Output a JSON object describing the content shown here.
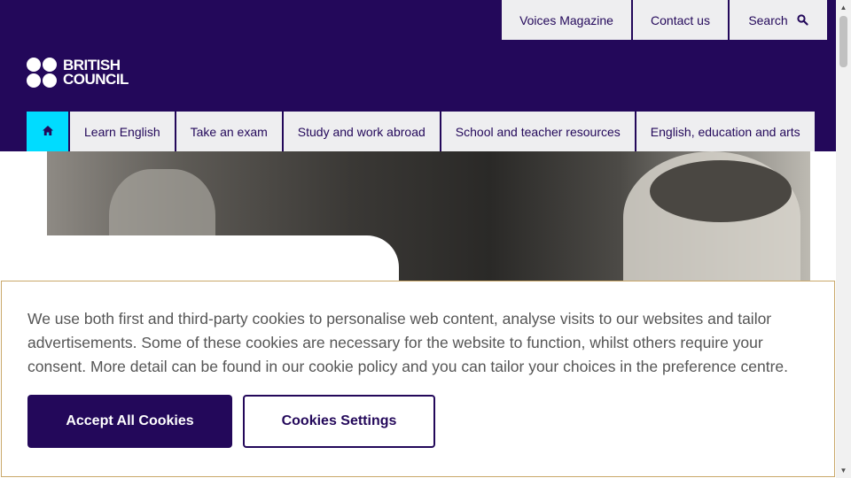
{
  "brand": {
    "line1": "BRITISH",
    "line2": "COUNCIL"
  },
  "util_nav": {
    "voices": "Voices Magazine",
    "contact": "Contact us",
    "search": "Search"
  },
  "main_nav": {
    "items": [
      "Learn English",
      "Take an exam",
      "Study and work abroad",
      "School and teacher resources",
      "English, education and arts"
    ]
  },
  "cookie_banner": {
    "text": "We use both first and third-party cookies to personalise web content, analyse visits to our websites and tailor advertisements. Some of these cookies are necessary for the website to function, whilst others require your consent. More detail can be found in our cookie policy and you can tailor your choices in the preference centre.",
    "accept_label": "Accept All Cookies",
    "settings_label": "Cookies Settings"
  },
  "colors": {
    "brand_purple": "#23085a",
    "home_cyan": "#00dcff",
    "nav_bg": "#eeeef0"
  },
  "icons": {
    "search": "search-icon",
    "home": "home-icon"
  }
}
